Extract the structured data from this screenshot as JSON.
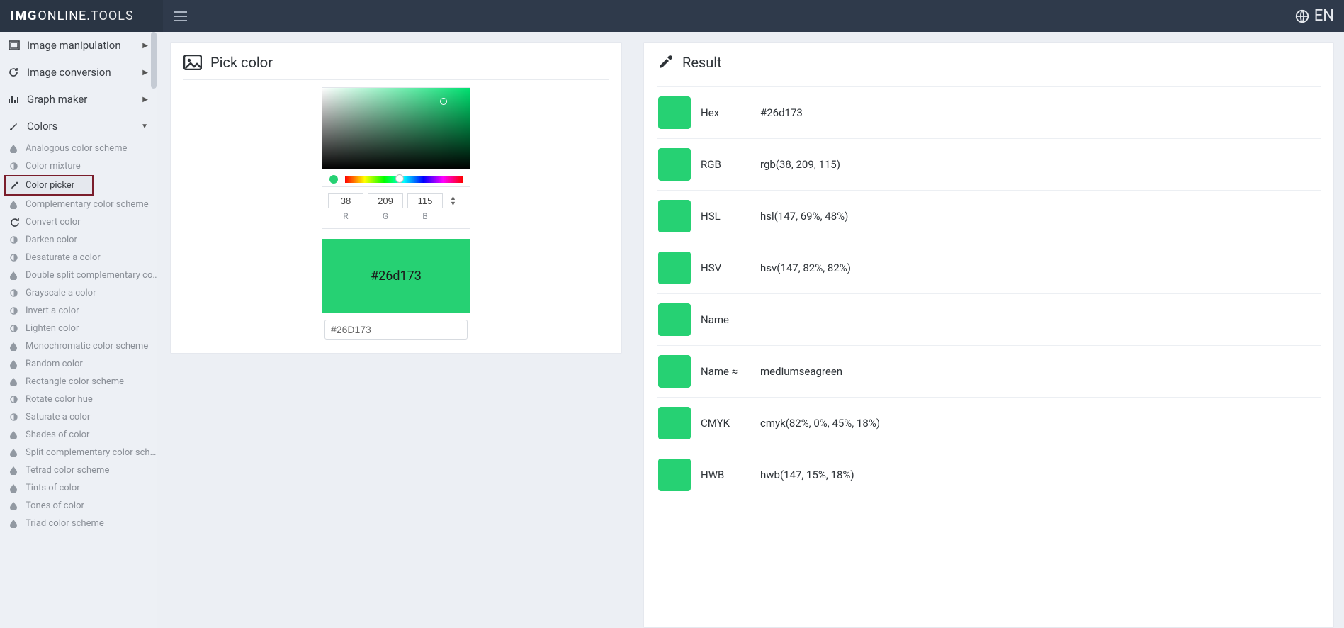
{
  "brand": {
    "bold": "IMG",
    "light": "ONLINE.",
    "tail": "TOOLS"
  },
  "lang": "EN",
  "sidebar": {
    "groups": [
      {
        "label": "Image manipulation",
        "icon": "frame"
      },
      {
        "label": "Image conversion",
        "icon": "refresh"
      },
      {
        "label": "Graph maker",
        "icon": "bar"
      },
      {
        "label": "Colors",
        "icon": "brush",
        "open": true
      }
    ],
    "colorItems": [
      {
        "label": "Analogous color scheme",
        "icon": "drop"
      },
      {
        "label": "Color mixture",
        "icon": "contrast"
      },
      {
        "label": "Color picker",
        "icon": "dropper",
        "active": true
      },
      {
        "label": "Complementary color scheme",
        "icon": "drop"
      },
      {
        "label": "Convert color",
        "icon": "refresh"
      },
      {
        "label": "Darken color",
        "icon": "contrast"
      },
      {
        "label": "Desaturate a color",
        "icon": "contrast"
      },
      {
        "label": "Double split complementary co…",
        "icon": "drop"
      },
      {
        "label": "Grayscale a color",
        "icon": "contrast"
      },
      {
        "label": "Invert a color",
        "icon": "contrast"
      },
      {
        "label": "Lighten color",
        "icon": "contrast"
      },
      {
        "label": "Monochromatic color scheme",
        "icon": "drop"
      },
      {
        "label": "Random color",
        "icon": "drop"
      },
      {
        "label": "Rectangle color scheme",
        "icon": "drop"
      },
      {
        "label": "Rotate color hue",
        "icon": "contrast"
      },
      {
        "label": "Saturate a color",
        "icon": "contrast"
      },
      {
        "label": "Shades of color",
        "icon": "drop"
      },
      {
        "label": "Split complementary color sch…",
        "icon": "drop"
      },
      {
        "label": "Tetrad color scheme",
        "icon": "drop"
      },
      {
        "label": "Tints of color",
        "icon": "drop"
      },
      {
        "label": "Tones of color",
        "icon": "drop"
      },
      {
        "label": "Triad color scheme",
        "icon": "drop"
      }
    ]
  },
  "picker": {
    "title": "Pick color",
    "r": "38",
    "g": "209",
    "b": "115",
    "labelR": "R",
    "labelG": "G",
    "labelB": "B",
    "swatchText": "#26d173",
    "hexInput": "#26D173",
    "color": "#26d173"
  },
  "result": {
    "title": "Result",
    "color": "#26d173",
    "rows": [
      {
        "key": "Hex",
        "val": "#26d173"
      },
      {
        "key": "RGB",
        "val": "rgb(38, 209, 115)"
      },
      {
        "key": "HSL",
        "val": "hsl(147, 69%, 48%)"
      },
      {
        "key": "HSV",
        "val": "hsv(147, 82%, 82%)"
      },
      {
        "key": "Name",
        "val": ""
      },
      {
        "key": "Name ≈",
        "val": "mediumseagreen"
      },
      {
        "key": "CMYK",
        "val": "cmyk(82%, 0%, 45%, 18%)"
      },
      {
        "key": "HWB",
        "val": "hwb(147, 15%, 18%)"
      }
    ]
  }
}
